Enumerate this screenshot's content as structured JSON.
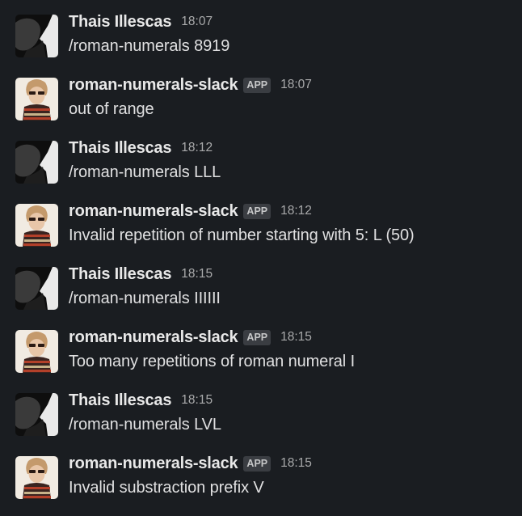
{
  "messages": [
    {
      "author": "Thais Illescas",
      "time": "18:07",
      "text": "/roman-numerals 8919",
      "avatar": "user-photo-icon"
    },
    {
      "author": "roman-numerals-slack",
      "badge": "APP",
      "time": "18:07",
      "text": "out of range",
      "avatar": "bot-photo-icon"
    },
    {
      "author": "Thais Illescas",
      "time": "18:12",
      "text": "/roman-numerals LLL",
      "avatar": "user-photo-icon"
    },
    {
      "author": "roman-numerals-slack",
      "badge": "APP",
      "time": "18:12",
      "text": "Invalid repetition of number starting with 5: L (50)",
      "avatar": "bot-photo-icon"
    },
    {
      "author": "Thais Illescas",
      "time": "18:15",
      "text": "/roman-numerals IIIIII",
      "avatar": "user-photo-icon"
    },
    {
      "author": "roman-numerals-slack",
      "badge": "APP",
      "time": "18:15",
      "text": "Too many repetitions of roman numeral I",
      "avatar": "bot-photo-icon"
    },
    {
      "author": "Thais Illescas",
      "time": "18:15",
      "text": "/roman-numerals LVL",
      "avatar": "user-photo-icon"
    },
    {
      "author": "roman-numerals-slack",
      "badge": "APP",
      "time": "18:15",
      "text": "Invalid substraction prefix V",
      "avatar": "bot-photo-icon"
    }
  ],
  "colors": {
    "background": "#1a1d21",
    "name": "#e8e8e8",
    "timestamp": "#a9aaab",
    "badge_bg": "#3a3d42"
  }
}
